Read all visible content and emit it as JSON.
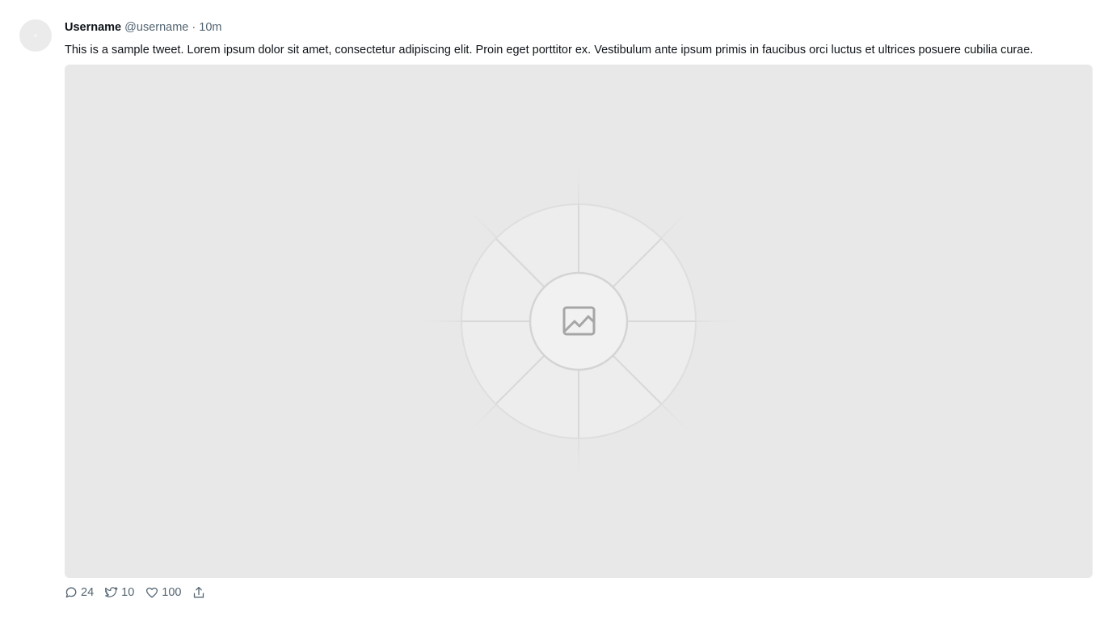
{
  "tweet": {
    "display_name": "Username",
    "handle": "@username",
    "separator": "·",
    "time": "10m",
    "text": "This is a sample tweet. Lorem ipsum dolor sit amet, consectetur adipiscing elit. Proin eget porttitor ex. Vestibulum ante ipsum primis in faucibus orci luctus et ultrices posuere cubilia curae.",
    "media": {
      "icon": "image-placeholder-icon",
      "background_color": "#e8e8e8"
    }
  },
  "actions": {
    "reply": {
      "icon": "reply-icon",
      "count": "24"
    },
    "retweet": {
      "icon": "retweet-icon",
      "count": "10"
    },
    "like": {
      "icon": "heart-icon",
      "count": "100"
    },
    "share": {
      "icon": "share-icon"
    }
  },
  "colors": {
    "text_primary": "#0f1419",
    "text_secondary": "#536471",
    "avatar_bg": "#ebebeb"
  }
}
